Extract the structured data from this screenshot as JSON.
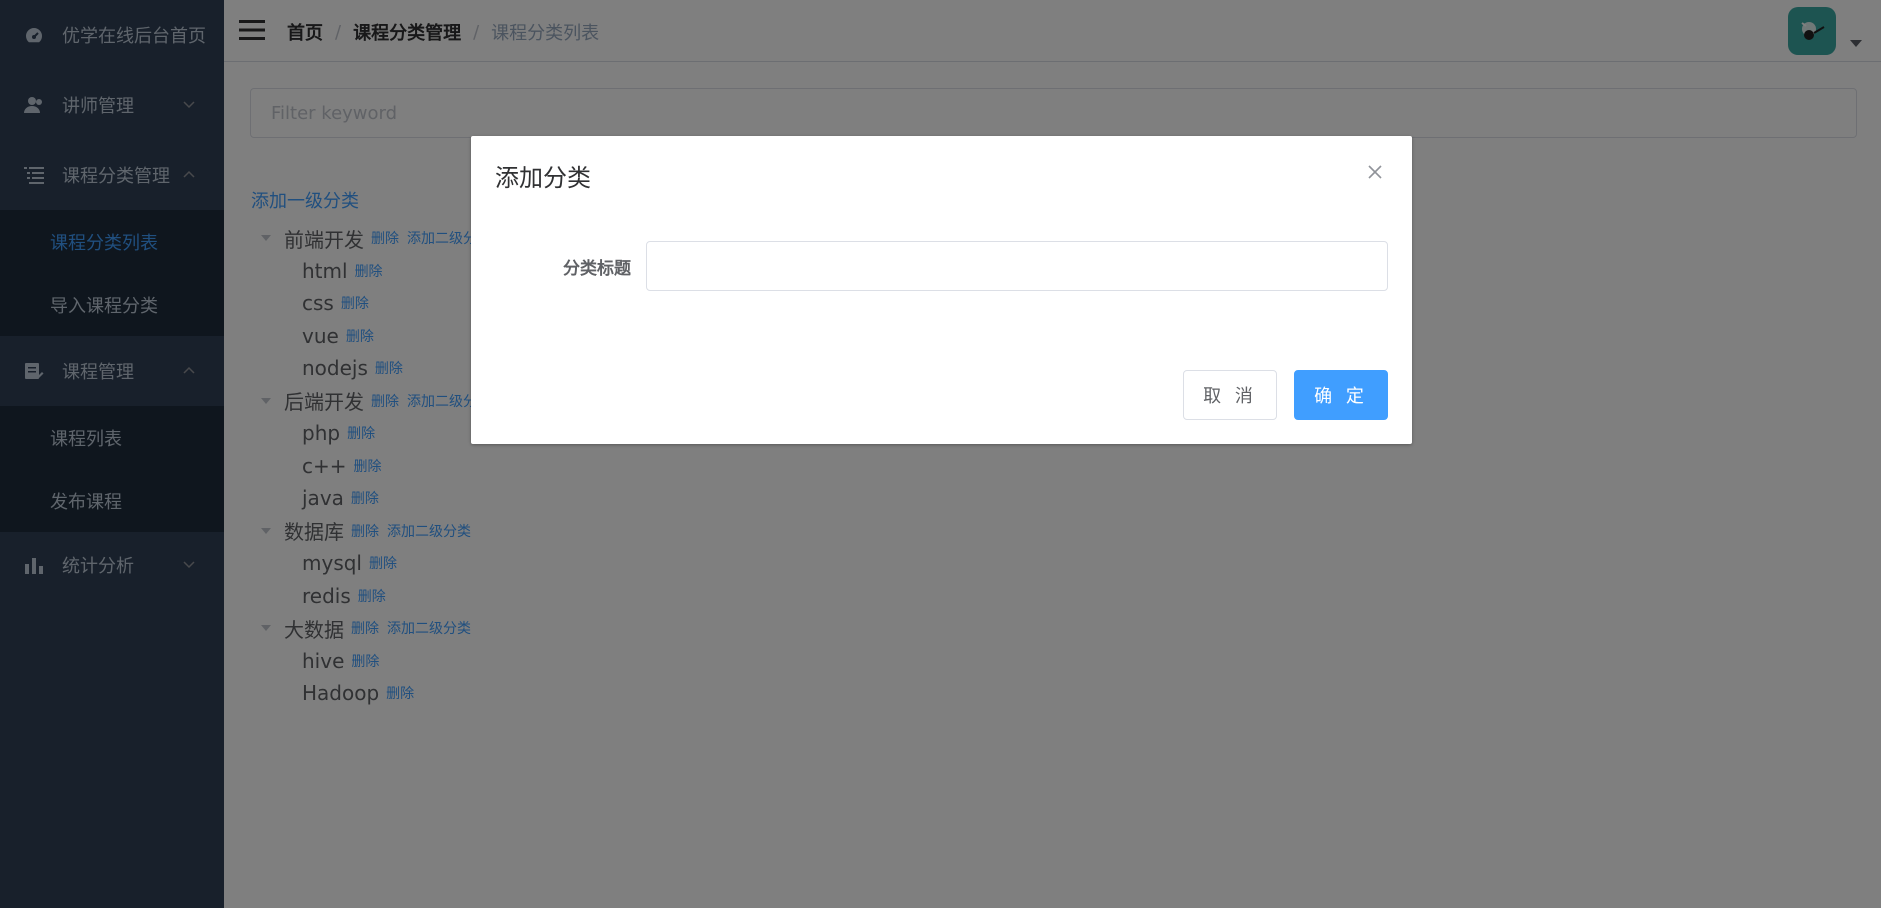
{
  "sidebar": {
    "items": [
      {
        "label": "优学在线后台首页",
        "icon": "dashboard-icon"
      },
      {
        "label": "讲师管理",
        "icon": "user-icon"
      },
      {
        "label": "课程分类管理",
        "icon": "list-icon"
      },
      {
        "label": "课程管理",
        "icon": "course-icon"
      },
      {
        "label": "统计分析",
        "icon": "chart-icon"
      }
    ],
    "category_sub": [
      "课程分类列表",
      "导入课程分类"
    ],
    "course_sub": [
      "课程列表",
      "发布课程"
    ]
  },
  "breadcrumb": [
    "首页",
    "课程分类管理",
    "课程分类列表"
  ],
  "filter": {
    "placeholder": "Filter keyword",
    "value": ""
  },
  "add_first_level": "添加一级分类",
  "tree": {
    "delete_label": "删除",
    "add_child_label": "添加二级分类",
    "groups": [
      {
        "label": "前端开发",
        "children": [
          "html",
          "css",
          "vue",
          "nodejs"
        ]
      },
      {
        "label": "后端开发",
        "children": [
          "php",
          "c++",
          "java"
        ]
      },
      {
        "label": "数据库",
        "children": [
          "mysql",
          "redis"
        ]
      },
      {
        "label": "大数据",
        "children": [
          "hive",
          "Hadoop"
        ]
      }
    ]
  },
  "dialog": {
    "title": "添加分类",
    "field_label": "分类标题",
    "field_value": "",
    "cancel": "取 消",
    "confirm": "确 定"
  },
  "colors": {
    "primary": "#409eff",
    "sidebar": "#304156",
    "submenu": "#1f2d3d"
  }
}
